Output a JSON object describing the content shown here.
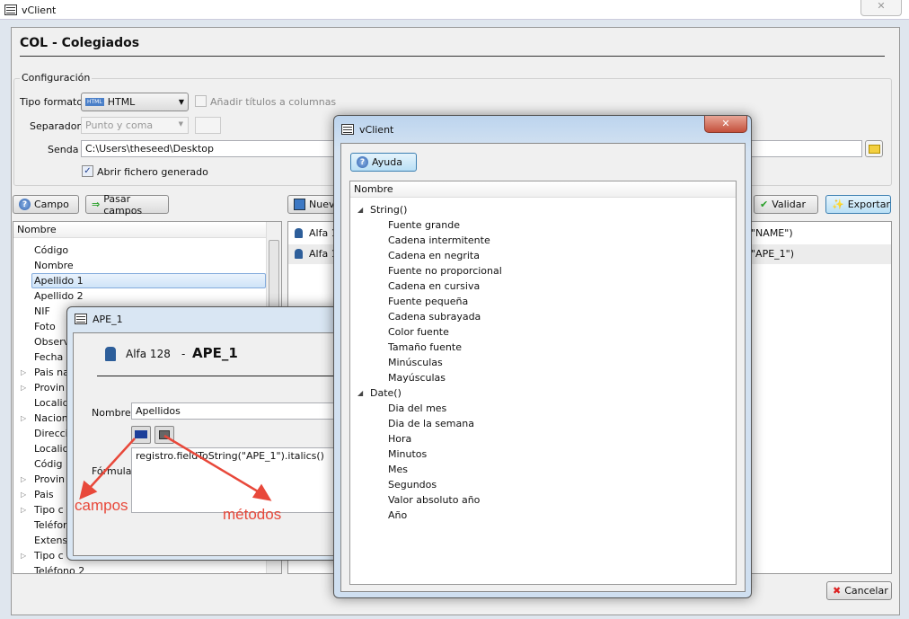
{
  "window": {
    "title": "vClient"
  },
  "header": {
    "title": "COL  -  Colegiados"
  },
  "config": {
    "legend": "Configuración",
    "tipo_formato_label": "Tipo formato",
    "tipo_formato_value": "HTML",
    "anadir_titulos_label": "Añadir títulos a columnas",
    "anadir_titulos_checked": false,
    "separador_label": "Separador",
    "separador_value": "Punto y coma",
    "senda_label": "Senda",
    "senda_value": "C:\\Users\\theseed\\Desktop",
    "abrir_label": "Abrir fichero generado",
    "abrir_checked": true
  },
  "toolbar": {
    "campo": "Campo",
    "pasar_campos": "Pasar campos",
    "nueva": "Nueva",
    "validar": "Validar",
    "exportar": "Exportar",
    "cancelar": "Cancelar"
  },
  "left_tree": {
    "header": "Nombre",
    "items": [
      {
        "label": "Código",
        "exp": false
      },
      {
        "label": "Nombre",
        "exp": false
      },
      {
        "label": "Apellido 1",
        "exp": false,
        "selected": true
      },
      {
        "label": "Apellido 2",
        "exp": false
      },
      {
        "label": "NIF",
        "exp": false
      },
      {
        "label": "Foto",
        "exp": false
      },
      {
        "label": "Observ",
        "exp": false
      },
      {
        "label": "Fecha n",
        "exp": false
      },
      {
        "label": "Pais na",
        "exp": true
      },
      {
        "label": "Provin",
        "exp": true
      },
      {
        "label": "Localid",
        "exp": false
      },
      {
        "label": "Nacion",
        "exp": true
      },
      {
        "label": "Direcci",
        "exp": false
      },
      {
        "label": "Localid",
        "exp": false
      },
      {
        "label": "Códig",
        "exp": false
      },
      {
        "label": "Provin",
        "exp": true
      },
      {
        "label": "Pais",
        "exp": true
      },
      {
        "label": "Tipo c",
        "exp": true
      },
      {
        "label": "Teléfon",
        "exp": false
      },
      {
        "label": "Extensi",
        "exp": false
      },
      {
        "label": "Tipo c",
        "exp": true
      },
      {
        "label": "Teléfono 2",
        "exp": false
      }
    ]
  },
  "right_list": {
    "rows": [
      {
        "type": "Alfa 1",
        "formula_tail": "\"NAME\")"
      },
      {
        "type": "Alfa 1",
        "formula_tail": "\"APE_1\")"
      }
    ]
  },
  "ape_dialog": {
    "title": "APE_1",
    "type": "Alfa 128",
    "sep": "-",
    "name": "APE_1",
    "nombre_label": "Nombre",
    "nombre_value": "Apellidos",
    "formula_label": "Fórmula",
    "formula_value": "registro.fieldToString(\"APE_1\").italics()"
  },
  "annotations": {
    "campos": "campos",
    "metodos": "métodos"
  },
  "help_dialog": {
    "title": "vClient",
    "ayuda": "Ayuda",
    "header": "Nombre",
    "groups": [
      {
        "label": "String()",
        "items": [
          "Fuente grande",
          "Cadena intermitente",
          "Cadena en negrita",
          "Fuente no proporcional",
          "Cadena en cursiva",
          "Fuente pequeña",
          "Cadena subrayada",
          "Color fuente",
          "Tamaño fuente",
          "Minúsculas",
          "Mayúsculas"
        ]
      },
      {
        "label": "Date()",
        "items": [
          "Dia del mes",
          "Dia de la semana",
          "Hora",
          "Minutos",
          "Mes",
          "Segundos",
          "Valor absoluto año",
          "Año"
        ]
      }
    ]
  },
  "colors": {
    "arrow": "#e8483a",
    "accent": "#3c7fb1"
  }
}
